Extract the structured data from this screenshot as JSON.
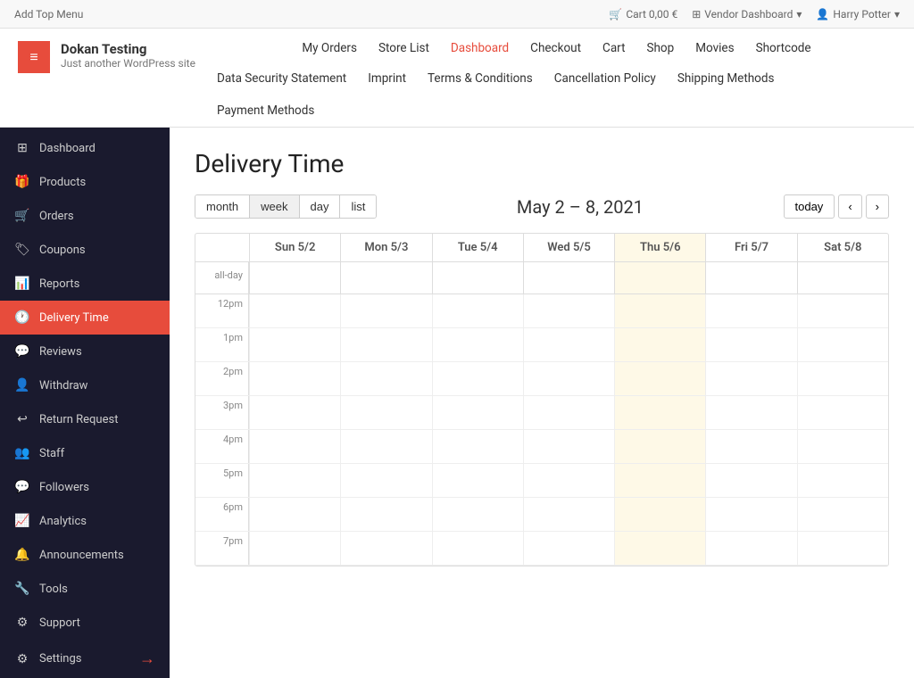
{
  "adminBar": {
    "left": "Add Top Menu",
    "cartLabel": "Cart 0,00 €",
    "vendorDashboard": "Vendor Dashboard",
    "user": "Harry Potter"
  },
  "mainNav": [
    {
      "label": "My Orders",
      "active": false
    },
    {
      "label": "Store List",
      "active": false
    },
    {
      "label": "Dashboard",
      "active": true
    },
    {
      "label": "Checkout",
      "active": false
    },
    {
      "label": "Cart",
      "active": false
    },
    {
      "label": "Shop",
      "active": false
    },
    {
      "label": "Movies",
      "active": false
    },
    {
      "label": "Shortcode",
      "active": false
    }
  ],
  "secondaryNav": [
    {
      "label": "Data Security Statement"
    },
    {
      "label": "Imprint"
    },
    {
      "label": "Terms & Conditions"
    },
    {
      "label": "Cancellation Policy"
    },
    {
      "label": "Shipping Methods"
    }
  ],
  "tertiaryNav": [
    {
      "label": "Payment Methods"
    }
  ],
  "site": {
    "name": "Dokan Testing",
    "tagline": "Just another WordPress site"
  },
  "sidebar": {
    "items": [
      {
        "id": "dashboard",
        "label": "Dashboard",
        "icon": "⊞",
        "active": false
      },
      {
        "id": "products",
        "label": "Products",
        "icon": "🎁",
        "active": false
      },
      {
        "id": "orders",
        "label": "Orders",
        "icon": "🛒",
        "active": false
      },
      {
        "id": "coupons",
        "label": "Coupons",
        "icon": "🏷",
        "active": false
      },
      {
        "id": "reports",
        "label": "Reports",
        "icon": "📊",
        "active": false
      },
      {
        "id": "delivery-time",
        "label": "Delivery Time",
        "icon": "🕐",
        "active": true
      },
      {
        "id": "reviews",
        "label": "Reviews",
        "icon": "💬",
        "active": false
      },
      {
        "id": "withdraw",
        "label": "Withdraw",
        "icon": "👤",
        "active": false
      },
      {
        "id": "return-request",
        "label": "Return Request",
        "icon": "↩",
        "active": false
      },
      {
        "id": "staff",
        "label": "Staff",
        "icon": "👥",
        "active": false
      },
      {
        "id": "followers",
        "label": "Followers",
        "icon": "💬",
        "active": false
      },
      {
        "id": "analytics",
        "label": "Analytics",
        "icon": "📈",
        "active": false
      },
      {
        "id": "announcements",
        "label": "Announcements",
        "icon": "🔔",
        "active": false
      },
      {
        "id": "tools",
        "label": "Tools",
        "icon": "🔧",
        "active": false
      },
      {
        "id": "support",
        "label": "Support",
        "icon": "⚙",
        "active": false
      }
    ],
    "settings": {
      "label": "Settings",
      "icon": "⚙"
    }
  },
  "calendar": {
    "pageTitle": "Delivery Time",
    "views": [
      "month",
      "week",
      "day",
      "list"
    ],
    "activeView": "week",
    "rangeLabel": "May 2 – 8, 2021",
    "todayBtn": "today",
    "columns": [
      {
        "label": "Sun 5/2",
        "highlight": false
      },
      {
        "label": "Mon 5/3",
        "highlight": false
      },
      {
        "label": "Tue 5/4",
        "highlight": false
      },
      {
        "label": "Wed 5/5",
        "highlight": false
      },
      {
        "label": "Thu 5/6",
        "highlight": true
      },
      {
        "label": "Fri 5/7",
        "highlight": false
      },
      {
        "label": "Sat 5/8",
        "highlight": false
      }
    ],
    "timeSlots": [
      "12pm",
      "1pm",
      "2pm",
      "3pm",
      "4pm",
      "5pm",
      "6pm",
      "7pm"
    ]
  }
}
